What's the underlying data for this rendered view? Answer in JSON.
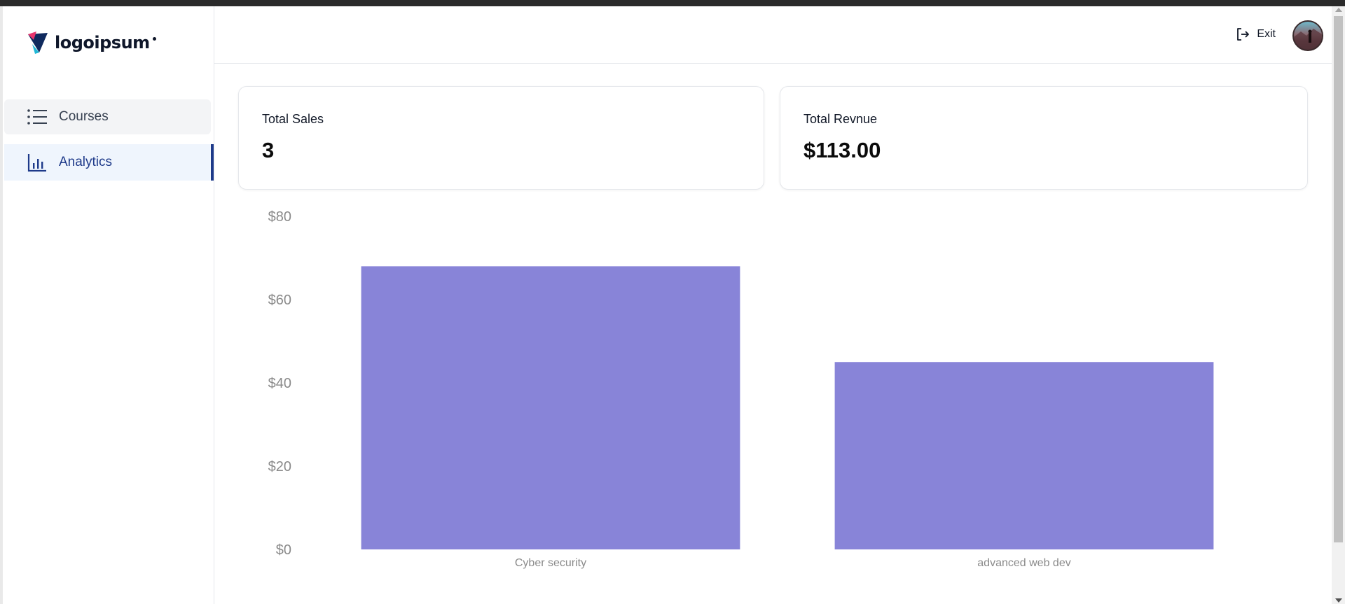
{
  "brand": {
    "name": "logoipsum",
    "colors": {
      "primary": "#1e3a8a",
      "bar": "#8884d8"
    }
  },
  "sidebar": {
    "items": [
      {
        "label": "Courses",
        "icon": "list-icon",
        "active": false
      },
      {
        "label": "Analytics",
        "icon": "bar-chart-icon",
        "active": true
      }
    ]
  },
  "header": {
    "exit_label": "Exit",
    "exit_icon": "logout-icon",
    "avatar_icon": "user-avatar"
  },
  "stats": {
    "total_sales": {
      "label": "Total Sales",
      "value": "3"
    },
    "total_revenue": {
      "label": "Total Revnue",
      "value": "$113.00"
    }
  },
  "chart_data": {
    "type": "bar",
    "categories": [
      "Cyber security",
      "advanced web dev"
    ],
    "values": [
      68,
      45
    ],
    "ylim": [
      0,
      80
    ],
    "yticks": [
      0,
      20,
      40,
      60,
      80
    ],
    "ytick_labels": [
      "$0",
      "$20",
      "$40",
      "$60",
      "$80"
    ],
    "title": "",
    "xlabel": "",
    "ylabel": "",
    "grid": false,
    "color": "#8884d8"
  }
}
